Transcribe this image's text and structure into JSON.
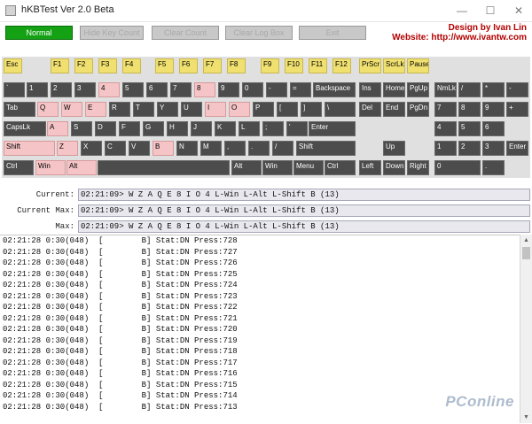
{
  "window": {
    "title": "hKBTest Ver 2.0 Beta",
    "minimize": "—",
    "maximize": "☐",
    "close": "✕"
  },
  "toolbar": {
    "buttons": [
      "Normal",
      "Hide Key Count",
      "Clear Count",
      "Clear Log Box",
      "Exit"
    ],
    "credit_line1": "Design by Ivan Lin",
    "credit_line2": "Website: http://www.ivantw.com"
  },
  "keyboard": {
    "pressed_keys": [
      "4",
      "8",
      "Q",
      "W",
      "E",
      "I",
      "O",
      "A",
      "Z",
      "B",
      "Shift",
      "Win",
      "Alt"
    ],
    "rows": {
      "function": [
        "Esc",
        "F1",
        "F2",
        "F3",
        "F4",
        "F5",
        "F6",
        "F7",
        "F8",
        "F9",
        "F10",
        "F11",
        "F12"
      ],
      "nav_top": [
        "PrScr",
        "ScrLk",
        "Pause"
      ],
      "number": [
        "`",
        "1",
        "2",
        "3",
        "4",
        "5",
        "6",
        "7",
        "8",
        "9",
        "0",
        "-",
        "=",
        "Backspace"
      ],
      "nav_mid1": [
        "Ins",
        "Home",
        "PgUp"
      ],
      "num1": [
        "NmLk",
        "/",
        "*",
        "-"
      ],
      "qwerty": [
        "Tab",
        "Q",
        "W",
        "E",
        "R",
        "T",
        "Y",
        "U",
        "I",
        "O",
        "P",
        "[",
        "]",
        "\\"
      ],
      "nav_mid2": [
        "Del",
        "End",
        "PgDn"
      ],
      "num2": [
        "7",
        "8",
        "9",
        "+"
      ],
      "home": [
        "CapsLk",
        "A",
        "S",
        "D",
        "F",
        "G",
        "H",
        "J",
        "K",
        "L",
        ";",
        "'",
        "Enter"
      ],
      "num3": [
        "4",
        "5",
        "6"
      ],
      "shift_row": [
        "Shift",
        "Z",
        "X",
        "C",
        "V",
        "B",
        "N",
        "M",
        ",",
        ".",
        "/",
        "Shift"
      ],
      "up": "Up",
      "num4": [
        "1",
        "2",
        "3",
        "Enter"
      ],
      "bottom": [
        "Ctrl",
        "Win",
        "Alt",
        "",
        "Alt",
        "Win",
        "Menu",
        "Ctrl"
      ],
      "arrows": [
        "Left",
        "Down",
        "Right"
      ],
      "num5": [
        "0",
        "."
      ]
    }
  },
  "status": {
    "current_label": "Current:",
    "current_value": "02:21:09> W Z A Q E 8 I O 4 L-Win L-Alt L-Shift B (13)",
    "current_max_label": "Current Max:",
    "current_max_value": "02:21:09> W Z A Q E 8 I O 4 L-Win L-Alt L-Shift B (13)",
    "max_label": "Max:",
    "max_value": "02:21:09> W Z A Q E 8 I O 4 L-Win L-Alt L-Shift B (13)"
  },
  "log": [
    "02:21:28 0:30(048)  [        B] Stat:DN Press:728",
    "02:21:28 0:30(048)  [        B] Stat:DN Press:727",
    "02:21:28 0:30(048)  [        B] Stat:DN Press:726",
    "02:21:28 0:30(048)  [        B] Stat:DN Press:725",
    "02:21:28 0:30(048)  [        B] Stat:DN Press:724",
    "02:21:28 0:30(048)  [        B] Stat:DN Press:723",
    "02:21:28 0:30(048)  [        B] Stat:DN Press:722",
    "02:21:28 0:30(048)  [        B] Stat:DN Press:721",
    "02:21:28 0:30(048)  [        B] Stat:DN Press:720",
    "02:21:28 0:30(048)  [        B] Stat:DN Press:719",
    "02:21:28 0:30(048)  [        B] Stat:DN Press:718",
    "02:21:28 0:30(048)  [        B] Stat:DN Press:717",
    "02:21:28 0:30(048)  [        B] Stat:DN Press:716",
    "02:21:28 0:30(048)  [        B] Stat:DN Press:715",
    "02:21:28 0:30(048)  [        B] Stat:DN Press:714",
    "02:21:28 0:30(048)  [        B] Stat:DN Press:713"
  ],
  "watermark": "PConline",
  "colors": {
    "active_button": "#14a114",
    "credit": "#b30000",
    "key": "#4c4c4c",
    "function_key": "#f0e070",
    "pressed_key": "#f4c4c6"
  }
}
